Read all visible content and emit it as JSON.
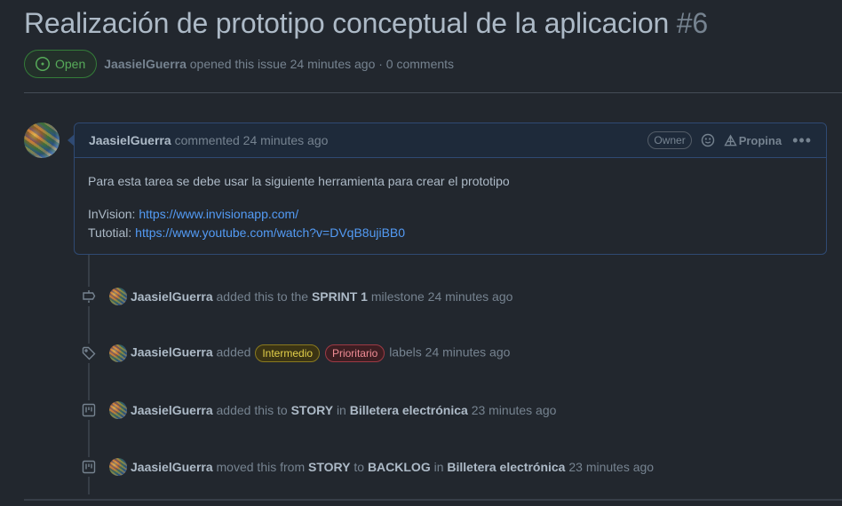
{
  "issue": {
    "title": "Realización de prototipo conceptual de la aplicacion",
    "number": "#6",
    "state": "Open",
    "author": "JaasielGuerra",
    "opened_text": "opened this issue 24 minutes ago · 0 comments"
  },
  "comment": {
    "author": "JaasielGuerra",
    "action": "commented 24 minutes ago",
    "owner_badge": "Owner",
    "tip_label": "Propina",
    "body": {
      "line1": "Para esta tarea se debe usar la siguiente herramienta para crear el prototipo",
      "invision_label": "InVision:",
      "invision_url": "https://www.invisionapp.com/",
      "tutorial_label": "Tutotial:",
      "tutorial_url": "https://www.youtube.com/watch?v=DVqB8ujiBB0"
    }
  },
  "events": [
    {
      "icon": "milestone-icon",
      "actor": "JaasielGuerra",
      "pre": "added this to the",
      "target": "SPRINT 1",
      "post": "milestone",
      "time": "24 minutes ago"
    },
    {
      "icon": "tag-icon",
      "actor": "JaasielGuerra",
      "pre": "added",
      "labels": [
        "Intermedio",
        "Prioritario"
      ],
      "post": "labels",
      "time": "24 minutes ago"
    },
    {
      "icon": "project-icon",
      "actor": "JaasielGuerra",
      "pre": "added this to",
      "column": "STORY",
      "mid": "in",
      "project": "Billetera electrónica",
      "time": "23 minutes ago"
    },
    {
      "icon": "project-icon",
      "actor": "JaasielGuerra",
      "pre": "moved this from",
      "from": "STORY",
      "to_word": "to",
      "to": "BACKLOG",
      "mid": "in",
      "project": "Billetera electrónica",
      "time": "23 minutes ago"
    }
  ],
  "colors": {
    "background": "#22272e",
    "open_green": "#57ab5a",
    "link_blue": "#539bf5",
    "label_intermedio": "#e3d04a",
    "label_prioritario": "#f08c95"
  }
}
